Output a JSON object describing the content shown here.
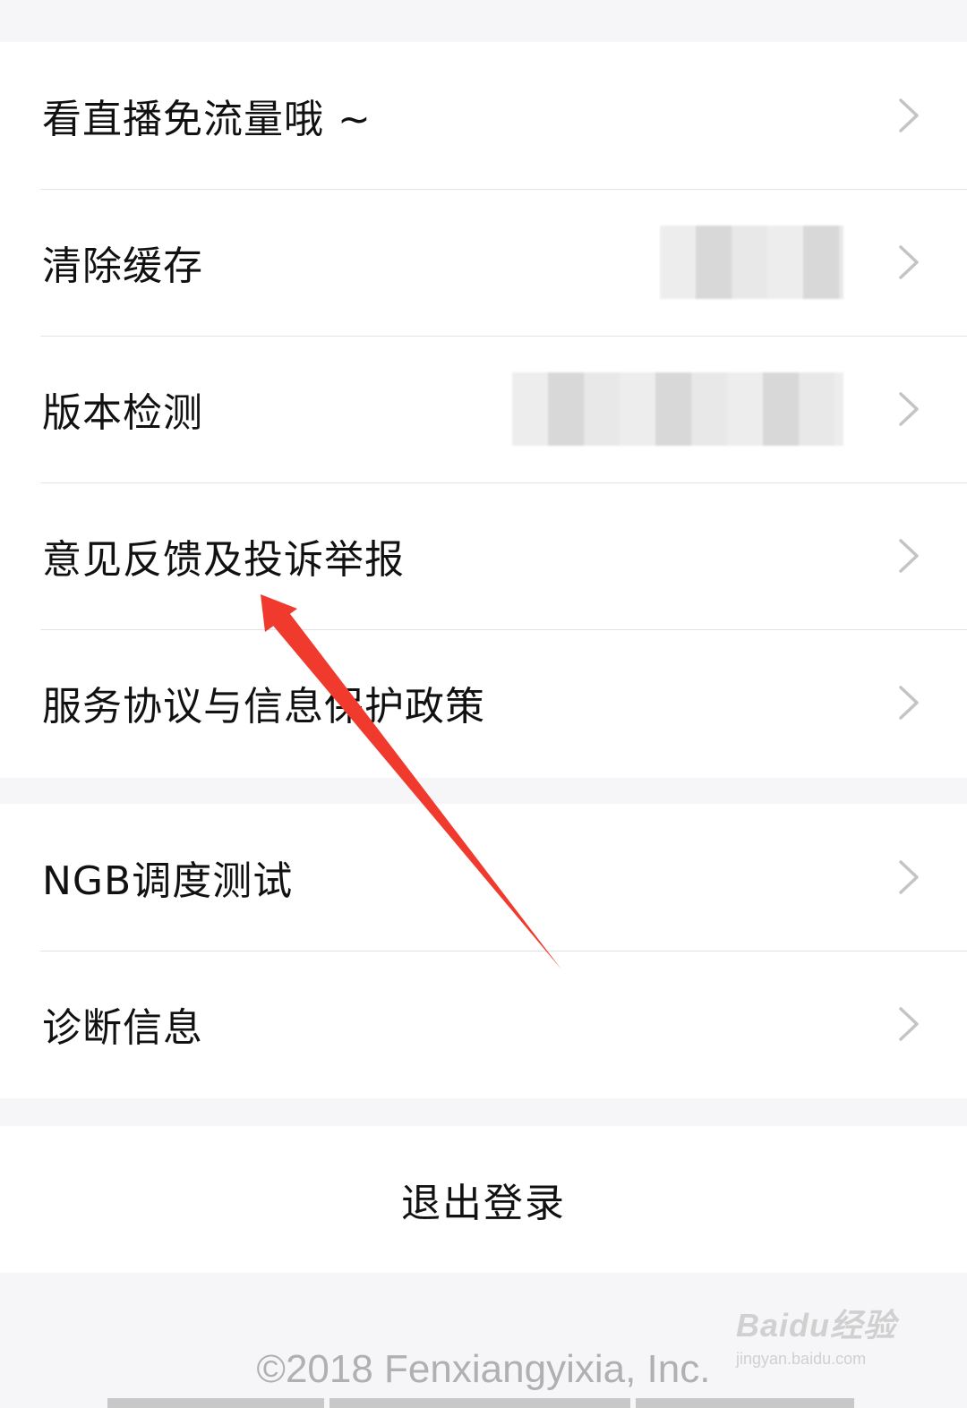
{
  "settings": {
    "group1": [
      {
        "label": "看直播免流量哦 ~"
      },
      {
        "label": "清除缓存"
      },
      {
        "label": "版本检测"
      },
      {
        "label": "意见反馈及投诉举报"
      },
      {
        "label": "服务协议与信息保护政策"
      }
    ],
    "group2": [
      {
        "label": "NGB调度测试"
      },
      {
        "label": "诊断信息"
      }
    ],
    "logout_label": "退出登录"
  },
  "footer": {
    "copyright": "©2018 Fenxiangyixia, Inc."
  },
  "watermark": {
    "brand": "Baidu经验",
    "url": "jingyan.baidu.com"
  },
  "colors": {
    "background": "#f6f6f8",
    "card": "#ffffff",
    "divider": "#e2e2e2",
    "chevron": "#c4c4c4",
    "annotation_arrow": "#f03a2e"
  },
  "icons": {
    "row_chevron": "chevron-right-icon"
  }
}
